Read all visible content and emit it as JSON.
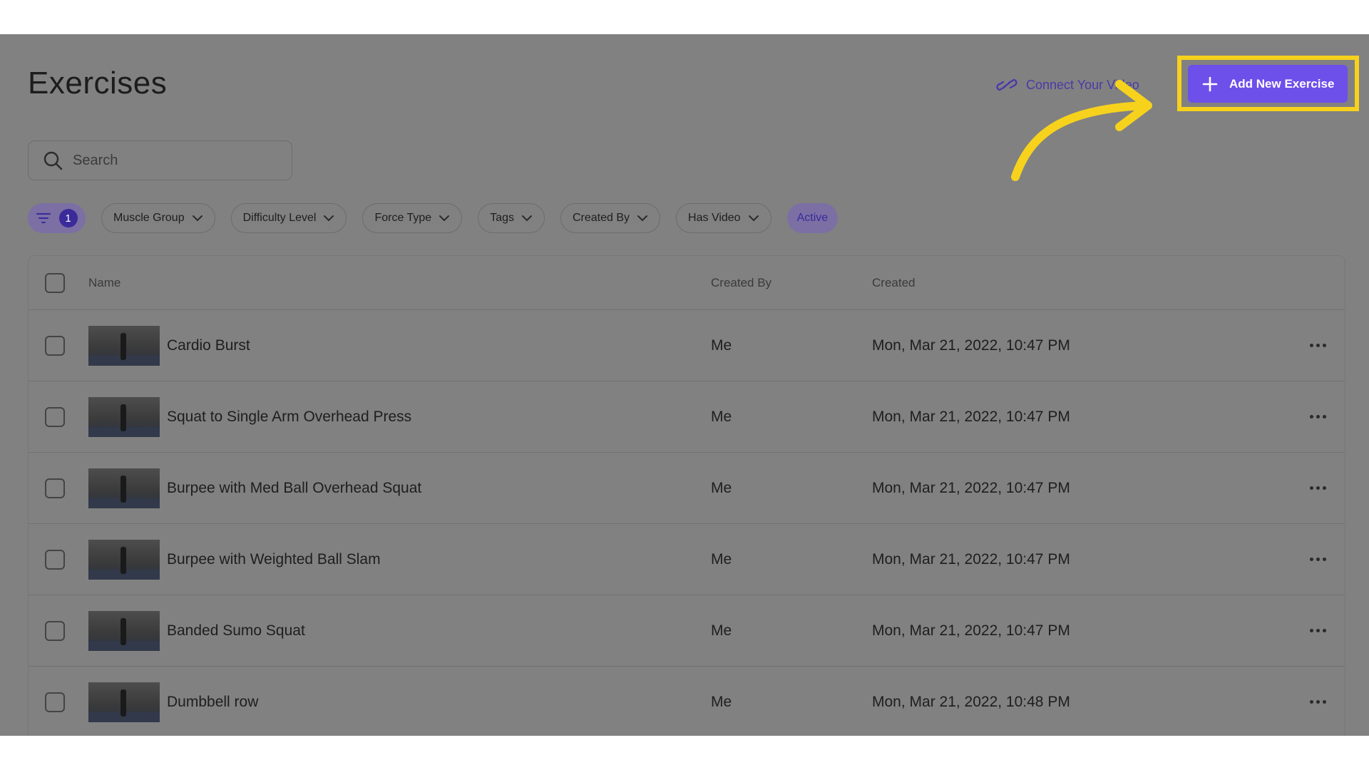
{
  "page": {
    "title": "Exercises"
  },
  "header": {
    "connect_label": "Connect Your Video",
    "add_button_label": "Add New Exercise"
  },
  "search": {
    "placeholder": "Search"
  },
  "filters": {
    "active_count": "1",
    "chips": [
      "Muscle Group",
      "Difficulty Level",
      "Force Type",
      "Tags",
      "Created By",
      "Has Video"
    ],
    "active_label": "Active"
  },
  "table": {
    "columns": {
      "name": "Name",
      "created_by": "Created By",
      "created": "Created"
    },
    "rows": [
      {
        "name": "Cardio Burst",
        "created_by": "Me",
        "created": "Mon, Mar 21, 2022, 10:47 PM"
      },
      {
        "name": "Squat to Single Arm Overhead Press",
        "created_by": "Me",
        "created": "Mon, Mar 21, 2022, 10:47 PM"
      },
      {
        "name": "Burpee with Med Ball Overhead Squat",
        "created_by": "Me",
        "created": "Mon, Mar 21, 2022, 10:47 PM"
      },
      {
        "name": "Burpee with Weighted Ball Slam",
        "created_by": "Me",
        "created": "Mon, Mar 21, 2022, 10:47 PM"
      },
      {
        "name": "Banded Sumo Squat",
        "created_by": "Me",
        "created": "Mon, Mar 21, 2022, 10:47 PM"
      },
      {
        "name": "Dumbbell row",
        "created_by": "Me",
        "created": "Mon, Mar 21, 2022, 10:48 PM"
      }
    ]
  },
  "colors": {
    "accent": "#6d4fea",
    "highlight": "#f7d21c",
    "overlay": "#818181"
  },
  "icons": {
    "search": "search-icon",
    "link": "link-icon",
    "plus": "plus-icon",
    "filter": "filter-icon",
    "chevron": "chevron-down-icon",
    "more": "more-horizontal-icon"
  }
}
